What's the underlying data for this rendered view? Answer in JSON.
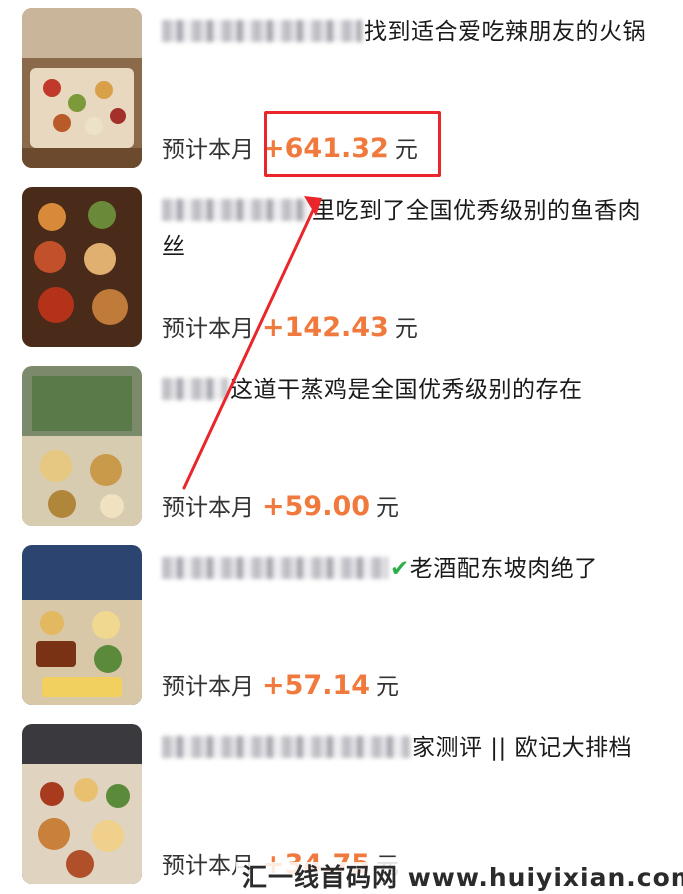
{
  "items": [
    {
      "title_visible": "找到适合爱吃辣朋友的火锅",
      "earn_prefix": "预计本月",
      "amount": "+641.32",
      "unit": "元",
      "thumb_colors": [
        "#6b4a2e",
        "#c8a078",
        "#e9d2b2",
        "#8d6a48"
      ]
    },
    {
      "title_visible": "里吃到了全国优秀级别的鱼香肉丝",
      "earn_prefix": "预计本月",
      "amount": "+142.43",
      "unit": "元",
      "thumb_colors": [
        "#5a2a14",
        "#c2602e",
        "#e0a060",
        "#7a3a1a"
      ]
    },
    {
      "title_visible": "这道干蒸鸡是全国优秀级别的存在",
      "earn_prefix": "预计本月",
      "amount": "+59.00",
      "unit": "元",
      "thumb_colors": [
        "#5b8060",
        "#bfae80",
        "#e8d6a8",
        "#7a5c34"
      ]
    },
    {
      "title_visible": "老酒配东坡肉绝了",
      "earn_prefix": "预计本月",
      "amount": "+57.14",
      "unit": "元",
      "thumb_colors": [
        "#243a66",
        "#c77a3a",
        "#e6c06a",
        "#7e3a18"
      ]
    },
    {
      "title_visible": "家测评 || 欧记大排档",
      "earn_prefix": "预计本月",
      "amount": "+34.75",
      "unit": "元",
      "thumb_colors": [
        "#2a2a2e",
        "#c88a44",
        "#e9cf9a",
        "#9c4a20"
      ]
    }
  ],
  "watermark": "汇一线首码网 www.huiyixian.com",
  "accent_color": "#f07a3d",
  "highlight_color": "#e8262b"
}
